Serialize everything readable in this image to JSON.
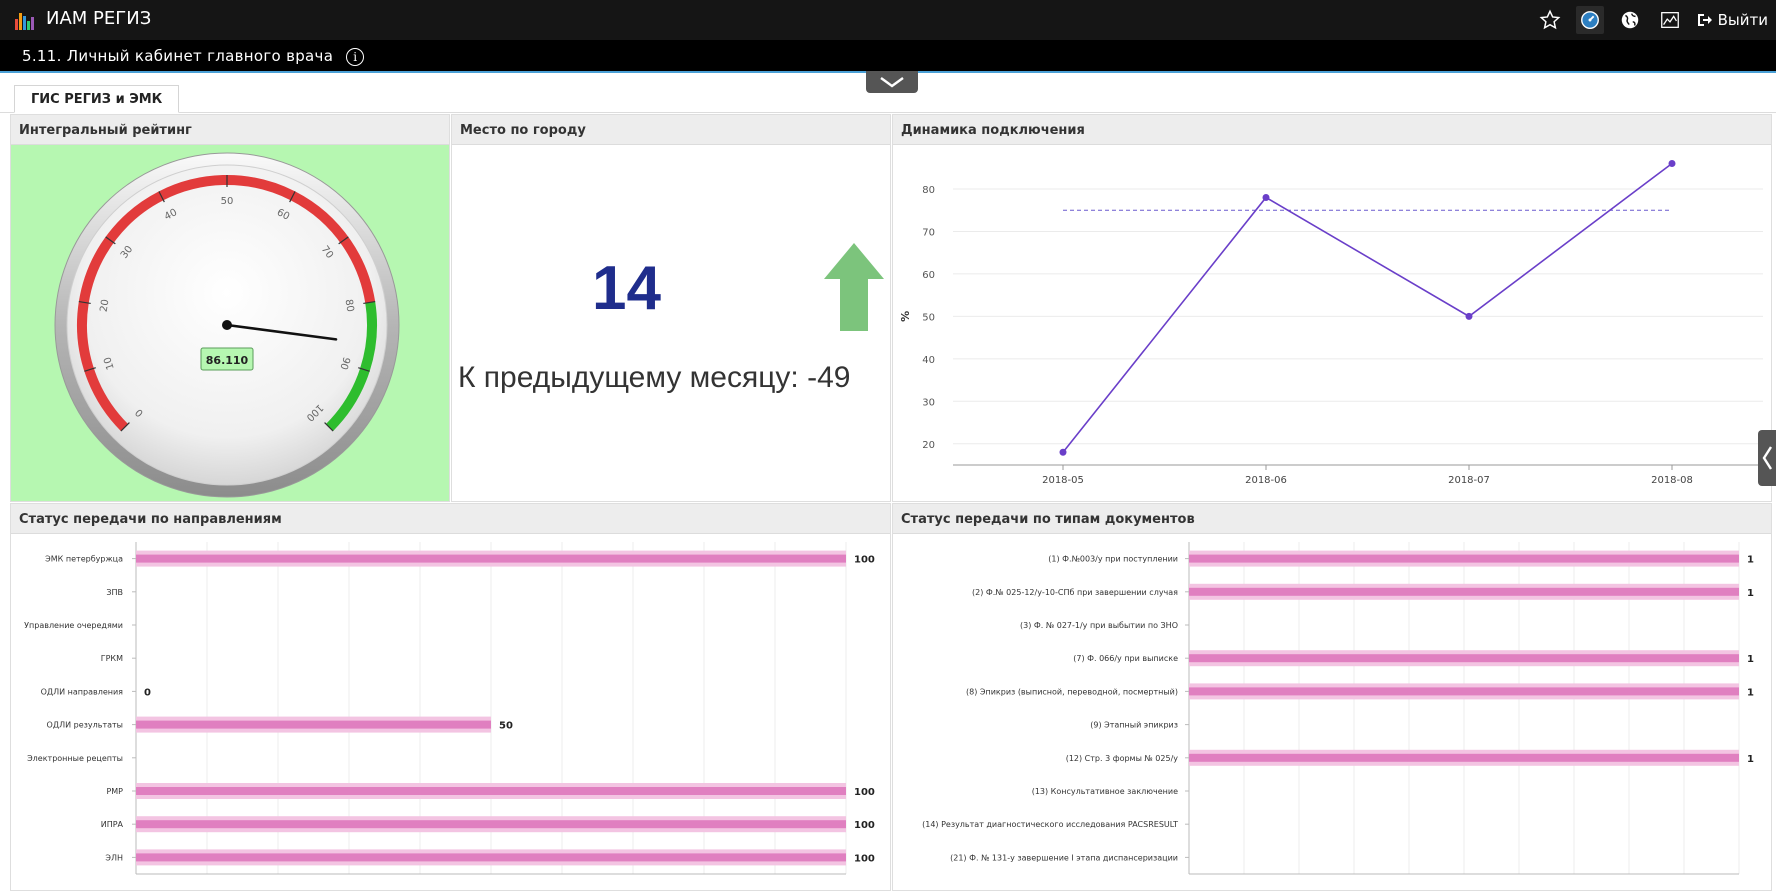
{
  "app": {
    "title": "ИАМ РЕГИЗ",
    "subtitle": "5.11. Личный кабинет главного врача",
    "info_glyph": "i",
    "logout_label": "Выйти",
    "icons": [
      "star-icon",
      "dashboard-icon",
      "globe-icon",
      "chart-icon",
      "logout-icon"
    ]
  },
  "tabs": [
    {
      "label": "ГИС РЕГИЗ и ЭМК"
    }
  ],
  "panels": {
    "rating": {
      "title": "Интегральный рейтинг",
      "value_label": "86.110",
      "value": 86.11,
      "gauge_min": 0,
      "gauge_max": 100,
      "ticks": [
        "0",
        "10",
        "20",
        "30",
        "40",
        "50",
        "60",
        "70",
        "80",
        "90",
        "100"
      ],
      "bands": [
        {
          "from": 0,
          "to": 80,
          "color": "#e23b3b"
        },
        {
          "from": 80,
          "to": 100,
          "color": "#2ebd2e"
        }
      ],
      "background": "#b6f7b1"
    },
    "place": {
      "title": "Место по городу",
      "value": "14",
      "change_text": "К предыдущему месяцу: -49",
      "arrow_color": "#7cc47c"
    },
    "dynamics": {
      "title": "Динамика подключения"
    },
    "status_dir": {
      "title": "Статус передачи по направлениям"
    },
    "status_doc": {
      "title": "Статус передачи по типам документов"
    }
  },
  "chart_data": [
    {
      "type": "line",
      "x": [
        "2018-05",
        "2018-06",
        "2018-07",
        "2018-08"
      ],
      "series": [
        {
          "values": [
            18,
            78,
            50,
            86
          ],
          "color": "#6a3fc9"
        }
      ],
      "reference_line": 75,
      "ylabel": "%",
      "yticks": [
        20,
        30,
        40,
        50,
        60,
        70,
        80
      ],
      "ylim": [
        15,
        88
      ]
    },
    {
      "type": "bar",
      "orientation": "horizontal",
      "categories": [
        "ЭМК петербуржца",
        "ЗПВ",
        "Управление очередями",
        "ГРКМ",
        "ОДЛИ направления",
        "ОДЛИ результаты",
        "Электронные рецепты",
        "РМР",
        "ИПРА",
        "ЭЛН"
      ],
      "values": [
        100,
        null,
        null,
        null,
        0,
        50,
        null,
        100,
        100,
        100
      ],
      "labels": [
        "100",
        "",
        "",
        "",
        "0",
        "50",
        "",
        "100",
        "100",
        "100"
      ],
      "xlim": [
        0,
        100
      ],
      "color": "#e07fc0"
    },
    {
      "type": "bar",
      "orientation": "horizontal",
      "categories": [
        "(1) Ф.№003/у при поступлении",
        "(2) Ф.№ 025-12/у-10-СПб при завершении случая",
        "(3) Ф. № 027-1/у при выбытии по ЗНО",
        "(7) Ф. 066/у при выписке",
        "(8) Эпикриз (выписной, переводной, посмертный)",
        "(9) Этапный эпикриз",
        "(12) Стр. 3 формы № 025/у",
        "(13) Консультативное заключение",
        "(14) Результат диагностического исследования PACSRESULT",
        "(21) Ф. № 131-у завершение I этапа диспансеризации"
      ],
      "values": [
        1,
        1,
        null,
        1,
        1,
        null,
        1,
        null,
        null,
        null
      ],
      "labels": [
        "1",
        "1",
        "",
        "1",
        "1",
        "",
        "1",
        "",
        "",
        ""
      ],
      "xlim": [
        0,
        1
      ],
      "color": "#e07fc0"
    }
  ]
}
